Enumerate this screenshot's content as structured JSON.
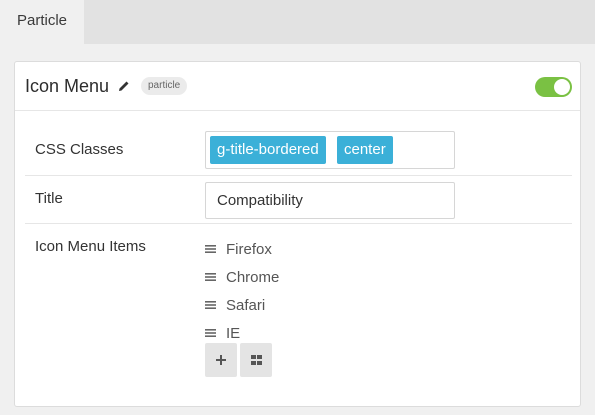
{
  "tabs": {
    "active_label": "Particle"
  },
  "card": {
    "title": "Icon Menu",
    "badge": "particle",
    "enabled": true
  },
  "fields": {
    "css_classes": {
      "label": "CSS Classes",
      "tags": [
        "g-title-bordered",
        "center"
      ]
    },
    "title": {
      "label": "Title",
      "value": "Compatibility"
    },
    "icon_menu_items": {
      "label": "Icon Menu Items",
      "items": [
        "Firefox",
        "Chrome",
        "Safari",
        "IE"
      ],
      "add_icon": "plus-icon",
      "grid_icon": "grid-icon"
    }
  },
  "colors": {
    "tag": "#3bb0d8",
    "toggle_on": "#7ac143"
  }
}
